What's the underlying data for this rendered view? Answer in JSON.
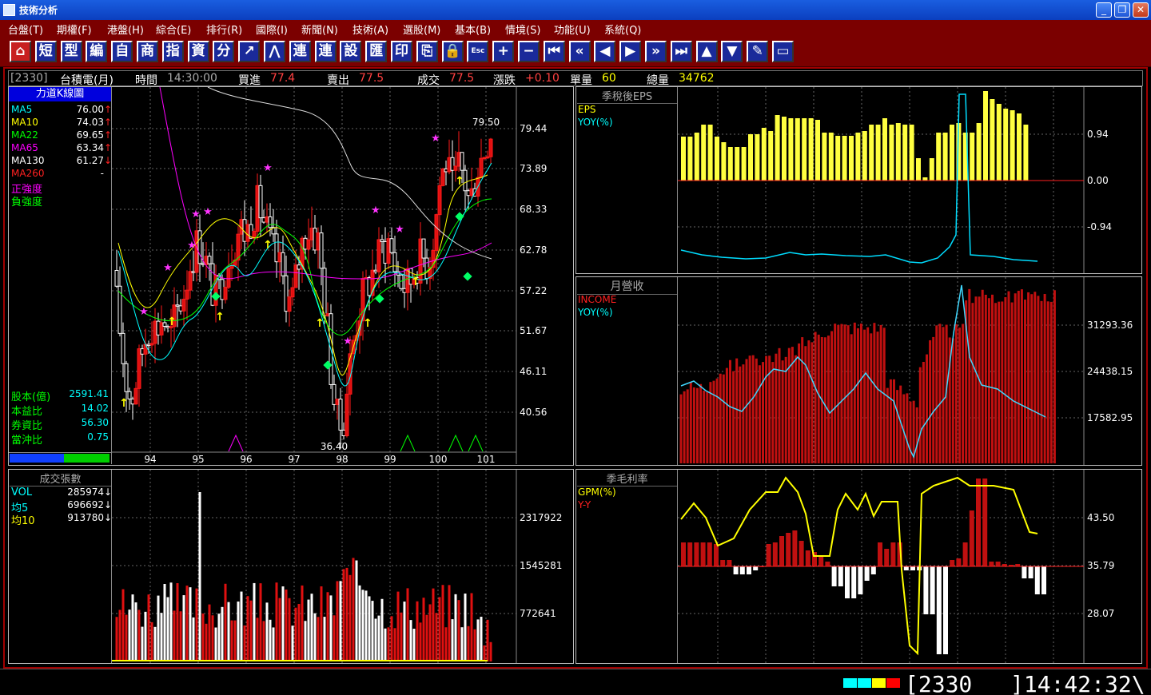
{
  "window": {
    "title": "技術分析",
    "min_label": "_",
    "restore_label": "❐",
    "close_label": "✕"
  },
  "menu": [
    "台盤(T)",
    "期權(F)",
    "港盤(H)",
    "綜合(E)",
    "排行(R)",
    "國際(I)",
    "新聞(N)",
    "技術(A)",
    "選股(M)",
    "基本(B)",
    "情境(S)",
    "功能(U)",
    "系統(Q)"
  ],
  "toolbar": [
    "⌂",
    "短",
    "型",
    "編",
    "自",
    "商",
    "指",
    "資",
    "分",
    "↗",
    "⋀",
    "連",
    "連",
    "設",
    "匯",
    "印",
    "⎘",
    "🔒",
    "Esc",
    "+",
    "−",
    "⏮",
    "«",
    "◀",
    "▶",
    "»",
    "⏭",
    "▲",
    "▼",
    "✎",
    "▭"
  ],
  "quote": {
    "code": "[2330]",
    "name": "台積電(月)",
    "time_label": "時間",
    "time": "14:30:00",
    "bid_label": "買進",
    "bid": "77.4",
    "ask_label": "賣出",
    "ask": "77.5",
    "deal_label": "成交",
    "deal": "77.5",
    "change_label": "漲跌",
    "change": "+0.10",
    "vol_label": "單量",
    "vol": "60",
    "total_label": "總量",
    "total": "34762"
  },
  "kline": {
    "title": "力道K線圖",
    "ma": [
      {
        "name": "MA5",
        "value": "76.00",
        "arrow": "↑",
        "color": "#00ffff"
      },
      {
        "name": "MA10",
        "value": "74.03",
        "arrow": "↑",
        "color": "#ffff00"
      },
      {
        "name": "MA22",
        "value": "69.65",
        "arrow": "↑",
        "color": "#00ff00"
      },
      {
        "name": "MA65",
        "value": "63.34",
        "arrow": "↑",
        "color": "#ff00ff"
      },
      {
        "name": "MA130",
        "value": "61.27",
        "arrow": "↓",
        "color": "#ffffff"
      },
      {
        "name": "MA260",
        "value": "-",
        "arrow": "",
        "color": "#ff2020"
      }
    ],
    "pos_strength": "正強度",
    "neg_strength": "負強度",
    "stats": [
      {
        "label": "股本(億)",
        "value": "2591.41"
      },
      {
        "label": "本益比",
        "value": "14.02"
      },
      {
        "label": "券資比",
        "value": "56.30"
      },
      {
        "label": "當沖比",
        "value": "0.75"
      }
    ],
    "y_ticks": [
      "79.44",
      "73.89",
      "68.33",
      "62.78",
      "57.22",
      "51.67",
      "46.11",
      "40.56"
    ],
    "x_ticks": [
      "94",
      "95",
      "96",
      "97",
      "98",
      "99",
      "100",
      "101"
    ],
    "high_label": "79.50",
    "low_label": "36.40"
  },
  "volume": {
    "title": "成交張數",
    "rows": [
      {
        "label": "VOL",
        "value": "285974",
        "arrow": "↓",
        "color": "#00ffff"
      },
      {
        "label": "均5",
        "value": "696692",
        "arrow": "↓",
        "color": "#00ffff"
      },
      {
        "label": "均10",
        "value": "913780",
        "arrow": "↓",
        "color": "#ffff00"
      }
    ],
    "y_ticks": [
      "2317922",
      "1545281",
      "772641"
    ]
  },
  "eps": {
    "title": "季稅後EPS",
    "legend": [
      {
        "name": "EPS",
        "color": "#ffff00"
      },
      {
        "name": "YOY(%)",
        "color": "#00ffff"
      }
    ],
    "y_ticks": [
      "0.94",
      "0.00",
      "-0.94"
    ]
  },
  "revenue": {
    "title": "月營收",
    "legend": [
      {
        "name": "INCOME",
        "color": "#ff2020"
      },
      {
        "name": "YOY(%)",
        "color": "#00ffff"
      }
    ],
    "y_ticks": [
      "31293.36",
      "24438.15",
      "17582.95"
    ]
  },
  "gpm": {
    "title": "季毛利率",
    "legend": [
      {
        "name": "GPM(%)",
        "color": "#ffff00"
      },
      {
        "name": "Y-Y",
        "color": "#ff2020"
      }
    ],
    "y_ticks": [
      "43.50",
      "35.79",
      "28.07"
    ]
  },
  "status": {
    "colors": [
      "#00ffff",
      "#00ffff",
      "#ffff00",
      "#ff0000"
    ],
    "code": "[2330_",
    "time": "]14:42:32\\"
  }
}
